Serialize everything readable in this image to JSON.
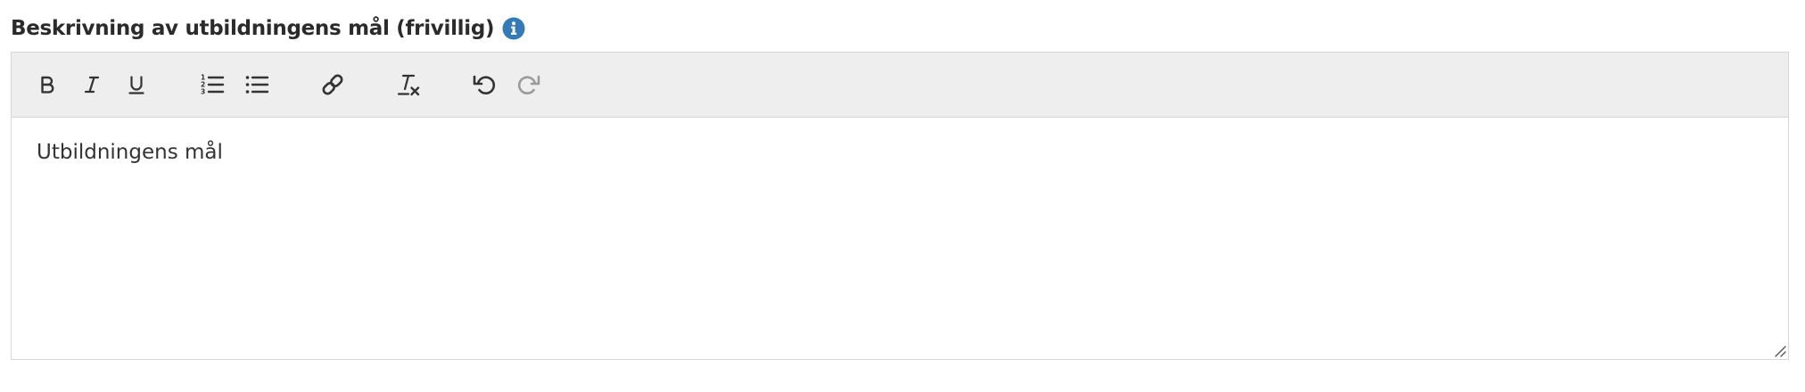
{
  "field": {
    "label": "Beskrivning av utbildningens mål (frivillig)",
    "info_icon": "info-circle-icon"
  },
  "toolbar": {
    "buttons": [
      {
        "name": "bold",
        "icon": "bold-icon"
      },
      {
        "name": "italic",
        "icon": "italic-icon"
      },
      {
        "name": "underline",
        "icon": "underline-icon"
      },
      {
        "name": "ordered-list",
        "icon": "numbered-list-icon"
      },
      {
        "name": "bullet-list",
        "icon": "bullet-list-icon"
      },
      {
        "name": "link",
        "icon": "link-icon"
      },
      {
        "name": "clear-formatting",
        "icon": "clear-formatting-icon"
      },
      {
        "name": "undo",
        "icon": "undo-icon"
      },
      {
        "name": "redo",
        "icon": "redo-icon",
        "disabled": true
      }
    ]
  },
  "editor": {
    "content": "Utbildningens mål"
  },
  "colors": {
    "info_blue": "#337ab7",
    "toolbar_bg": "#eeeeee",
    "icon": "#333333",
    "icon_disabled": "#9a9a9a",
    "border": "#d6d6d6"
  }
}
